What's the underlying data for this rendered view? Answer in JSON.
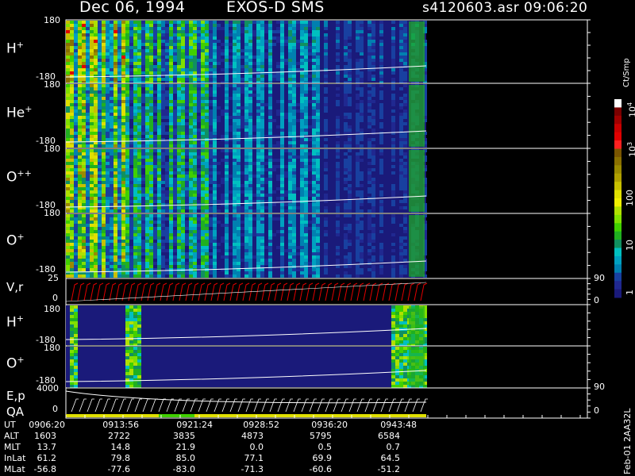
{
  "header": {
    "date": "Dec 06, 1994",
    "instrument": "EXOS-D SMS",
    "file": "s4120603.asr",
    "time": "09:06:20"
  },
  "panels": [
    {
      "id": "h1",
      "label": "H",
      "sup": "+",
      "top": "180",
      "bottom": "-180"
    },
    {
      "id": "he",
      "label": "He",
      "sup": "+",
      "top": "180",
      "bottom": "-180"
    },
    {
      "id": "opp",
      "label": "O",
      "sup": "++",
      "top": "180",
      "bottom": "-180"
    },
    {
      "id": "op",
      "label": "O",
      "sup": "+",
      "top": "180",
      "bottom": "-180"
    },
    {
      "id": "vr",
      "label": "V,r",
      "sup": "",
      "top": "25",
      "bottom": "0",
      "right_top": "90",
      "right_bottom": "0"
    },
    {
      "id": "h2",
      "label": "H",
      "sup": "+",
      "top": "180",
      "bottom": "-180"
    },
    {
      "id": "o2",
      "label": "O",
      "sup": "+",
      "top": "180",
      "bottom": "-180",
      "right_bottom": "90"
    },
    {
      "id": "ep",
      "label": "E,p",
      "label2": "QA",
      "sup": "",
      "top": "4000",
      "bottom": "0",
      "right_bottom": "0"
    }
  ],
  "colorbar": {
    "title": "Ct/Smp",
    "tick_labels": [
      "10",
      "10",
      "100",
      "10",
      "1"
    ],
    "tick_sups": [
      "4",
      "3",
      "",
      "",
      ""
    ],
    "colors": [
      "#ffffff",
      "#7a0000",
      "#a00000",
      "#c80000",
      "#e00000",
      "#ff2020",
      "#7a5500",
      "#8a7000",
      "#9a8a00",
      "#b0a000",
      "#c8c000",
      "#e0e000",
      "#f0f000",
      "#b0e000",
      "#80e000",
      "#40d000",
      "#20b020",
      "#109060",
      "#00c0c0",
      "#00a0c0",
      "#0080b0",
      "#1840a0",
      "#202890",
      "#1a1a7a"
    ]
  },
  "ephemeris": {
    "row_names": [
      "UT",
      "ALT",
      "MLT",
      "InLat",
      "MLat"
    ],
    "columns": [
      [
        "0906:20",
        "1603",
        "13.7",
        "61.2",
        "-56.8"
      ],
      [
        "0913:56",
        "2722",
        "14.8",
        "79.8",
        "-77.6"
      ],
      [
        "0921:24",
        "3835",
        "21.9",
        "85.0",
        "-83.0"
      ],
      [
        "0928:52",
        "4873",
        "0.0",
        "77.1",
        "-71.3"
      ],
      [
        "0936:20",
        "5795",
        "0.5",
        "69.9",
        "-60.6"
      ],
      [
        "0943:48",
        "6584",
        "0.7",
        "64.5",
        "-51.2"
      ]
    ]
  },
  "footer_id": "Feb-01 2AA32L",
  "chart_data": {
    "type": "heatmap",
    "title": "Dec 06, 1994   EXOS-D SMS",
    "x_tick_labels": [
      "0906:20",
      "0913:56",
      "0921:24",
      "0928:52",
      "0936:20",
      "0943:48"
    ],
    "colorbar_unit": "Ct/Smp",
    "colorbar_scale": "log",
    "colorbar_range": [
      1,
      10000
    ],
    "series": [
      {
        "name": "H+",
        "ylim": [
          -180,
          180
        ]
      },
      {
        "name": "He+",
        "ylim": [
          -180,
          180
        ]
      },
      {
        "name": "O++",
        "ylim": [
          -180,
          180
        ]
      },
      {
        "name": "O+",
        "ylim": [
          -180,
          180
        ]
      },
      {
        "name": "V,r",
        "ylim": [
          0,
          25
        ],
        "right_axis": [
          0,
          90
        ]
      },
      {
        "name": "H+",
        "ylim": [
          -180,
          180
        ]
      },
      {
        "name": "O+",
        "ylim": [
          -180,
          180
        ],
        "right_axis": [
          90
        ]
      },
      {
        "name": "E,p",
        "ylim": [
          0,
          4000
        ],
        "right_axis": [
          0
        ]
      }
    ]
  }
}
